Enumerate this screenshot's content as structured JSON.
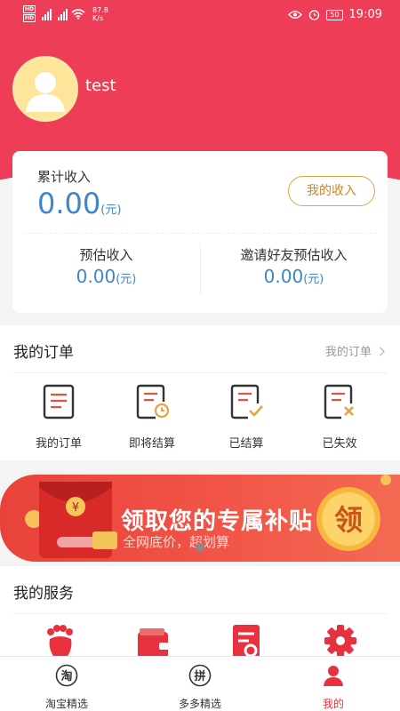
{
  "status_bar": {
    "hd1": "HD",
    "hd2": "HD",
    "net1": "4G",
    "net2": "4G",
    "speed_value": "87.8",
    "speed_unit": "K/s",
    "battery": "50",
    "time": "19:09"
  },
  "profile": {
    "username": "test"
  },
  "income_card": {
    "total_label": "累计收入",
    "total_value": "0.00",
    "total_unit": "(元)",
    "my_income_button": "我的收入",
    "estimated_label": "预估收入",
    "estimated_value": "0.00",
    "estimated_unit": "(元)",
    "invite_label": "邀请好友预估收入",
    "invite_value": "0.00",
    "invite_unit": "(元)"
  },
  "orders": {
    "title": "我的订单",
    "more_link": "我的订单",
    "items": [
      {
        "label": "我的订单",
        "icon": "order-list-icon"
      },
      {
        "label": "即将结算",
        "icon": "order-pending-icon"
      },
      {
        "label": "已结算",
        "icon": "order-settled-icon"
      },
      {
        "label": "已失效",
        "icon": "order-invalid-icon"
      }
    ]
  },
  "banner": {
    "title": "领取您的专属补贴",
    "subtitle": "全网底价，超划算",
    "badge": "领",
    "envelope_mark": "¥"
  },
  "services": {
    "title": "我的服务",
    "icons": [
      "footprint-icon",
      "wallet-icon",
      "document-search-icon",
      "gear-icon"
    ]
  },
  "tab_bar": {
    "tabs": [
      {
        "label": "淘宝精选",
        "glyph": "淘",
        "active": false
      },
      {
        "label": "多多精选",
        "glyph": "拼",
        "active": false
      },
      {
        "label": "我的",
        "active": true
      }
    ]
  },
  "colors": {
    "header_red": "#ee3d57",
    "amount_blue": "#3f86c9",
    "income_button_orange": "#d5821e",
    "active_tab": "#e8313f"
  }
}
